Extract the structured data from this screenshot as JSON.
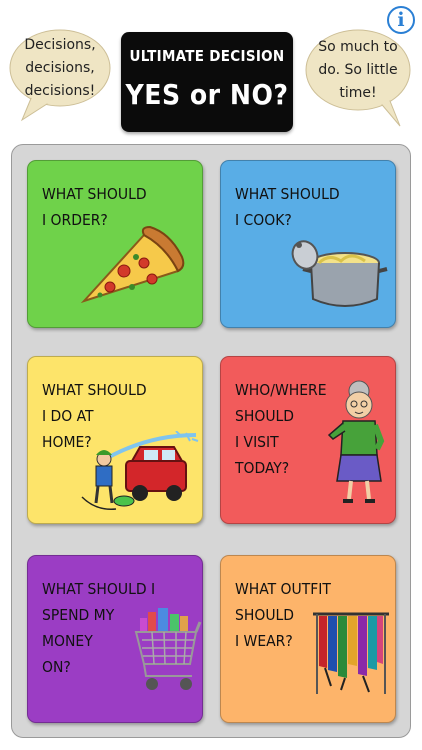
{
  "header": {
    "info_label": "i",
    "left_bubble_text": "Decisions,\ndecisions,\ndecisions!",
    "right_bubble_text": "So much to\ndo. So little\ntime!",
    "title_line1": "ULTIMATE DECISION",
    "title_line2": "YES or NO?"
  },
  "cards": [
    {
      "label": "WHAT SHOULD\nI ORDER?",
      "color": "#6fd24a",
      "icon": "pizza-icon"
    },
    {
      "label": "WHAT SHOULD\nI COOK?",
      "color": "#59ade6",
      "icon": "cooking-pot-icon"
    },
    {
      "label": "WHAT SHOULD\nI DO AT\nHOME?",
      "color": "#fde46a",
      "icon": "car-wash-icon"
    },
    {
      "label": "WHO/WHERE\nSHOULD\nI VISIT\nTODAY?",
      "color": "#f25b5b",
      "icon": "grandma-icon"
    },
    {
      "label": "WHAT SHOULD I\nSPEND MY\nMONEY\nON?",
      "color": "#9b3dc4",
      "icon": "shopping-cart-icon"
    },
    {
      "label": "WHAT OUTFIT\nSHOULD\nI WEAR?",
      "color": "#fdb46a",
      "icon": "clothes-rack-icon"
    }
  ]
}
